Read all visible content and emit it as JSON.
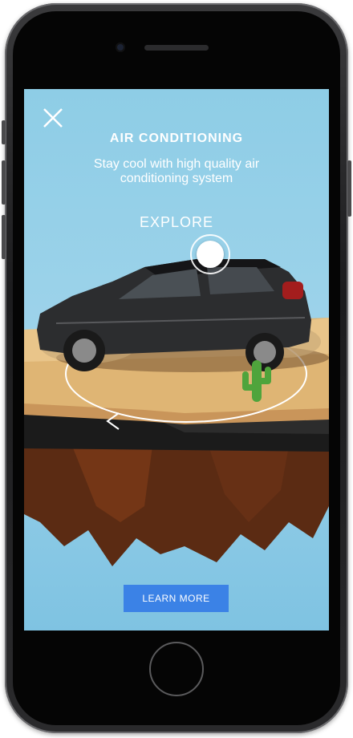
{
  "header": {
    "title": "AIR CONDITIONING",
    "subtitle": "Stay cool with high quality air conditioning system"
  },
  "hotspot": {
    "label": "EXPLORE"
  },
  "cta": {
    "label": "LEARN MORE"
  },
  "icons": {
    "close": "close-icon",
    "rotate": "rotate-arrow-icon"
  },
  "colors": {
    "sky": "#8ecde6",
    "button": "#3b82e6",
    "sand": "#e0b978",
    "dirt": "#5a2a12"
  }
}
